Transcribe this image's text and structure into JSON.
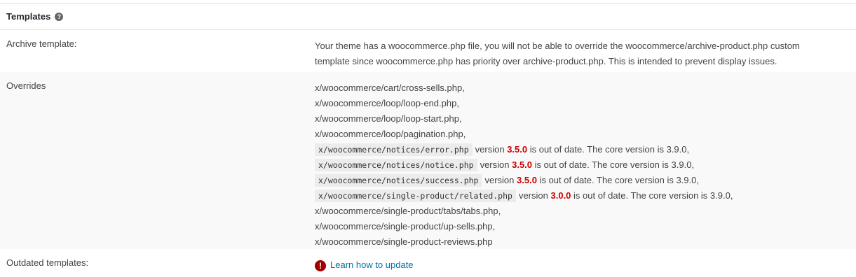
{
  "header": {
    "title": "Templates",
    "help_icon": "?"
  },
  "rows": [
    {
      "label": "Archive template:",
      "text_lines": [
        "Your theme has a woocommerce.php file, you will not be able to override the woocommerce/archive-product.php custom",
        "template since woocommerce.php has priority over archive-product.php. This is intended to prevent display issues."
      ]
    },
    {
      "label": "Overrides",
      "files": [
        {
          "path": "x/woocommerce/cart/cross-sells.php,"
        },
        {
          "path": "x/woocommerce/loop/loop-end.php,"
        },
        {
          "path": "x/woocommerce/loop/loop-start.php,"
        },
        {
          "path": "x/woocommerce/loop/pagination.php,"
        },
        {
          "path": "x/woocommerce/notices/error.php",
          "pre": "version",
          "version": "3.5.0",
          "post": "is out of date. The core version is 3.9.0,"
        },
        {
          "path": "x/woocommerce/notices/notice.php",
          "pre": "version",
          "version": "3.5.0",
          "post": "is out of date. The core version is 3.9.0,"
        },
        {
          "path": "x/woocommerce/notices/success.php",
          "pre": "version",
          "version": "3.5.0",
          "post": "is out of date. The core version is 3.9.0,"
        },
        {
          "path": "x/woocommerce/single-product/related.php",
          "pre": "version",
          "version": "3.0.0",
          "post": "is out of date. The core version is 3.9.0,"
        },
        {
          "path": "x/woocommerce/single-product/tabs/tabs.php,"
        },
        {
          "path": "x/woocommerce/single-product/up-sells.php,"
        },
        {
          "path": "x/woocommerce/single-product-reviews.php"
        }
      ]
    },
    {
      "label": "Outdated templates:",
      "icon": "!",
      "link_text": "Learn how to update"
    }
  ],
  "colors": {
    "link": "#0073aa",
    "outdated_version": "#cc0000",
    "error_icon": "#a00000"
  }
}
